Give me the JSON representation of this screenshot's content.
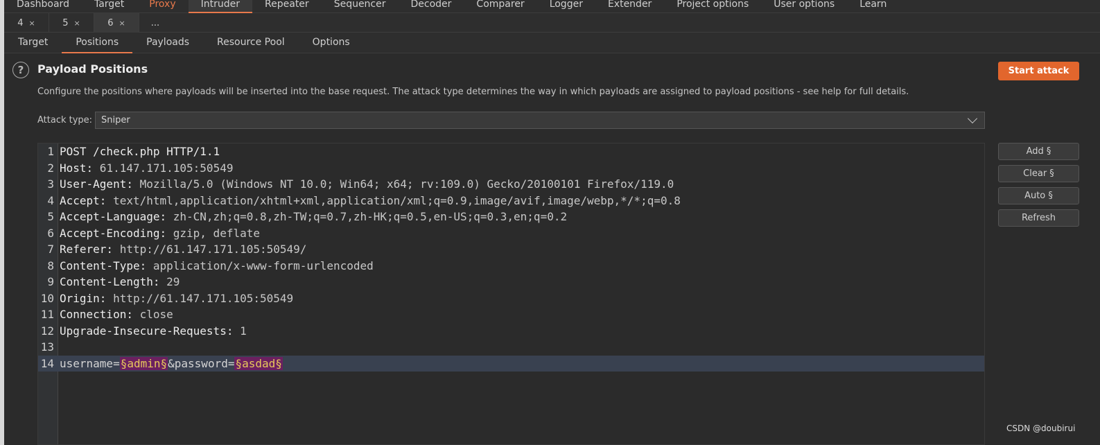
{
  "nav": {
    "items": [
      "Dashboard",
      "Target",
      "Proxy",
      "Intruder",
      "Repeater",
      "Sequencer",
      "Decoder",
      "Comparer",
      "Logger",
      "Extender",
      "Project options",
      "User options",
      "Learn"
    ],
    "active": "Intruder",
    "accent": "#e8794b"
  },
  "tabs": [
    {
      "label": "4",
      "close": "×"
    },
    {
      "label": "5",
      "close": "×"
    },
    {
      "label": "6",
      "close": "×"
    },
    {
      "label": "...",
      "close": ""
    }
  ],
  "subtabs": [
    "Target",
    "Positions",
    "Payloads",
    "Resource Pool",
    "Options"
  ],
  "panel": {
    "help_icon": "?",
    "title": "Payload Positions",
    "description": "Configure the positions where payloads will be inserted into the base request. The attack type determines the way in which payloads are assigned to payload positions - see help for full details.",
    "start_attack": "Start attack",
    "attack_type_label": "Attack type:",
    "attack_type_value": "Sniper"
  },
  "editor": {
    "lines": [
      {
        "n": "1",
        "key": "POST /check.php HTTP/1.1",
        "val": ""
      },
      {
        "n": "2",
        "key": "Host:",
        "val": " 61.147.171.105:50549"
      },
      {
        "n": "3",
        "key": "User-Agent:",
        "val": " Mozilla/5.0 (Windows NT 10.0; Win64; x64; rv:109.0) Gecko/20100101 Firefox/119.0"
      },
      {
        "n": "4",
        "key": "Accept:",
        "val": " text/html,application/xhtml+xml,application/xml;q=0.9,image/avif,image/webp,*/*;q=0.8"
      },
      {
        "n": "5",
        "key": "Accept-Language:",
        "val": " zh-CN,zh;q=0.8,zh-TW;q=0.7,zh-HK;q=0.5,en-US;q=0.3,en;q=0.2"
      },
      {
        "n": "6",
        "key": "Accept-Encoding:",
        "val": " gzip, deflate"
      },
      {
        "n": "7",
        "key": "Referer:",
        "val": " http://61.147.171.105:50549/"
      },
      {
        "n": "8",
        "key": "Content-Type:",
        "val": " application/x-www-form-urlencoded"
      },
      {
        "n": "9",
        "key": "Content-Length:",
        "val": " 29"
      },
      {
        "n": "10",
        "key": "Origin:",
        "val": " http://61.147.171.105:50549"
      },
      {
        "n": "11",
        "key": "Connection:",
        "val": " close"
      },
      {
        "n": "12",
        "key": "Upgrade-Insecure-Requests:",
        "val": " 1"
      },
      {
        "n": "13",
        "key": "",
        "val": ""
      }
    ],
    "body_line": {
      "n": "14",
      "p1": "username=",
      "m1": "§admin§",
      "p2": "&password=",
      "m2": "§asdad§"
    }
  },
  "side_buttons": [
    "Add §",
    "Clear §",
    "Auto §",
    "Refresh"
  ],
  "watermark": "CSDN @doubirui"
}
